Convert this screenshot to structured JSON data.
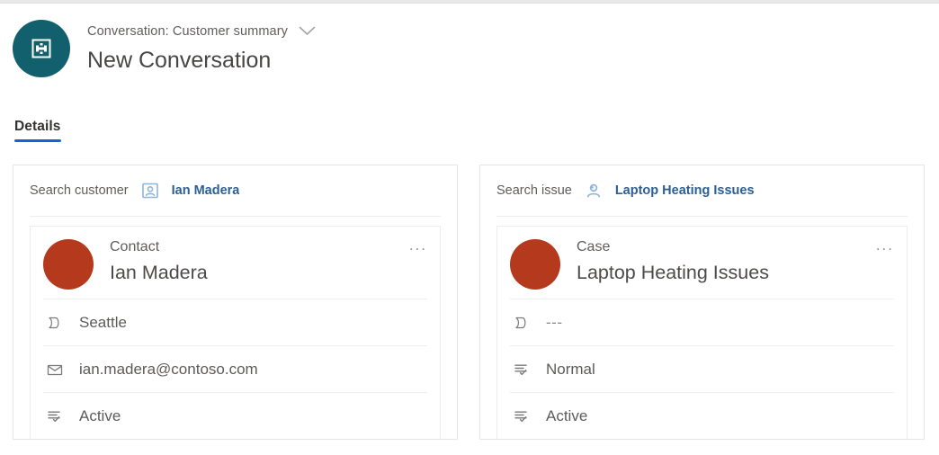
{
  "header": {
    "avatar_icon": "conversation-badge-icon",
    "subtitle": "Conversation: Customer summary",
    "chevron_icon": "chevron-down-icon",
    "title": "New Conversation",
    "avatar_color": "#12606e"
  },
  "tabs": [
    {
      "label": "Details",
      "active": true
    }
  ],
  "accent_color": "#1267cf",
  "cards": [
    {
      "search": {
        "label": "Search customer",
        "icon": "contact-card-icon",
        "value": "Ian Madera"
      },
      "record": {
        "avatar_color": "#b5391c",
        "type": "Contact",
        "name": "Ian Madera",
        "overflow_icon": "more-options-icon",
        "overflow_label": "...",
        "fields": [
          {
            "icon": "location-icon",
            "value": "Seattle"
          },
          {
            "icon": "email-icon",
            "value": "ian.madera@contoso.com"
          },
          {
            "icon": "status-icon",
            "value": "Active"
          }
        ]
      }
    },
    {
      "search": {
        "label": "Search issue",
        "icon": "person-icon",
        "value": "Laptop Heating Issues"
      },
      "record": {
        "avatar_color": "#b5391c",
        "type": "Case",
        "name": "Laptop Heating Issues",
        "overflow_icon": "more-options-icon",
        "overflow_label": "...",
        "fields": [
          {
            "icon": "location-icon",
            "value": "---",
            "muted": true
          },
          {
            "icon": "priority-icon",
            "value": "Normal"
          },
          {
            "icon": "status-icon",
            "value": "Active"
          }
        ]
      }
    }
  ]
}
